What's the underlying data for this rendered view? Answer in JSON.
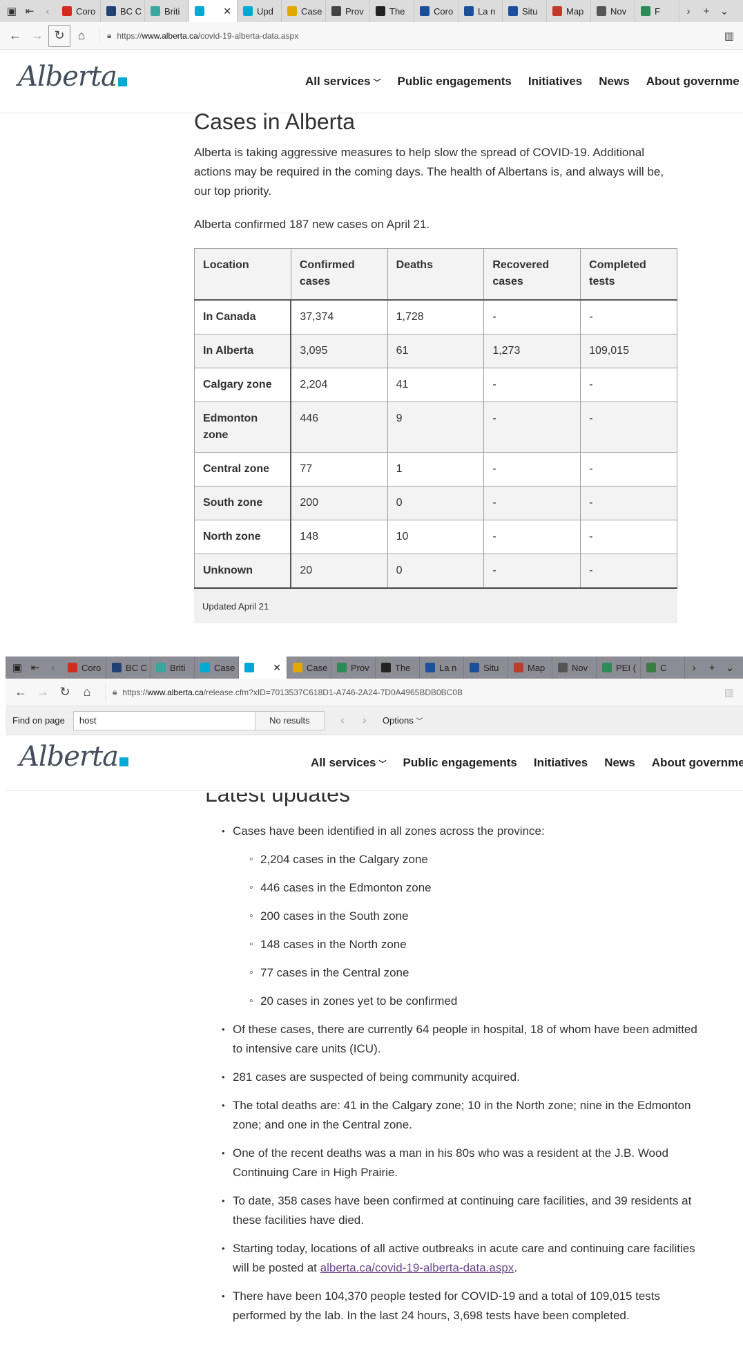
{
  "window1": {
    "tabs": [
      {
        "title": "Coro",
        "color": "#d52b1e",
        "active": false
      },
      {
        "title": "BC C",
        "color": "#234075",
        "active": false
      },
      {
        "title": "Briti",
        "color": "#3aa6a0",
        "active": false
      },
      {
        "title": "",
        "color": "#00aad2",
        "active": true
      },
      {
        "title": "Upd",
        "color": "#00aad2",
        "active": false
      },
      {
        "title": "Case",
        "color": "#e0a800",
        "active": false
      },
      {
        "title": "Prov",
        "color": "#444444",
        "active": false
      },
      {
        "title": "The",
        "color": "#222222",
        "active": false
      },
      {
        "title": "Coro",
        "color": "#1b4f9c",
        "active": false
      },
      {
        "title": "La n",
        "color": "#1b4f9c",
        "active": false
      },
      {
        "title": "Situ",
        "color": "#1b4f9c",
        "active": false
      },
      {
        "title": "Map",
        "color": "#c0392b",
        "active": false
      },
      {
        "title": "Nov",
        "color": "#555555",
        "active": false
      },
      {
        "title": "F",
        "color": "#2e8b57",
        "active": false
      }
    ],
    "url_prefix": "https://",
    "url_host": "www.alberta.ca",
    "url_path": "/covid-19-alberta-data.aspx"
  },
  "header": {
    "logo_text": "Alberta",
    "nav": {
      "all_services": "All services",
      "public_engagements": "Public engagements",
      "initiatives": "Initiatives",
      "news": "News",
      "about": "About governme"
    }
  },
  "page1": {
    "title": "Cases in Alberta",
    "intro": "Alberta is taking aggressive measures to help slow the spread of COVID-19. Additional actions may be required in the coming days. The health of Albertans is, and always will be, our top priority.",
    "new_cases": "Alberta confirmed 187 new cases on April 21.",
    "table": {
      "headers": [
        "Location",
        "Confirmed cases",
        "Deaths",
        "Recovered cases",
        "Completed tests"
      ],
      "rows": [
        [
          "In Canada",
          "37,374",
          "1,728",
          "-",
          "-"
        ],
        [
          "In Alberta",
          "3,095",
          "61",
          "1,273",
          "109,015"
        ],
        [
          "Calgary zone",
          "2,204",
          "41",
          "-",
          "-"
        ],
        [
          "Edmonton zone",
          "446",
          "9",
          "-",
          "-"
        ],
        [
          "Central zone",
          "77",
          "1",
          "-",
          "-"
        ],
        [
          "South zone",
          "200",
          "0",
          "-",
          "-"
        ],
        [
          "North zone",
          "148",
          "10",
          "-",
          "-"
        ],
        [
          "Unknown",
          "20",
          "0",
          "-",
          "-"
        ]
      ],
      "caption": "Updated April 21"
    }
  },
  "window2": {
    "tabs": [
      {
        "title": "Coro",
        "color": "#d52b1e",
        "active": false
      },
      {
        "title": "BC C",
        "color": "#234075",
        "active": false
      },
      {
        "title": "Briti",
        "color": "#3aa6a0",
        "active": false
      },
      {
        "title": "Case",
        "color": "#00aad2",
        "active": false
      },
      {
        "title": "",
        "color": "#00aad2",
        "active": true
      },
      {
        "title": "Case",
        "color": "#e0a800",
        "active": false
      },
      {
        "title": "Prov",
        "color": "#2e8b57",
        "active": false
      },
      {
        "title": "The",
        "color": "#222222",
        "active": false
      },
      {
        "title": "La n",
        "color": "#1b4f9c",
        "active": false
      },
      {
        "title": "Situ",
        "color": "#1b4f9c",
        "active": false
      },
      {
        "title": "Map",
        "color": "#c0392b",
        "active": false
      },
      {
        "title": "Nov",
        "color": "#555555",
        "active": false
      },
      {
        "title": "PEI (",
        "color": "#2e8b57",
        "active": false
      },
      {
        "title": "C",
        "color": "#3a7d44",
        "active": false
      }
    ],
    "url_prefix": "https://",
    "url_host": "www.alberta.ca",
    "url_path": "/release.cfm?xID=7013537C618D1-A746-2A24-7D0A4965BDB0BC0B",
    "find": {
      "label": "Find on page",
      "query": "host",
      "results": "No results",
      "options": "Options"
    }
  },
  "page2": {
    "heading": "Latest updates",
    "bullets": [
      {
        "text": "Cases have been identified in all zones across the province:",
        "sub": [
          "2,204 cases in the Calgary zone",
          "446 cases in the Edmonton zone",
          "200 cases in the South zone",
          "148 cases in the North zone",
          "77 cases in the Central zone",
          "20 cases in zones yet to be confirmed"
        ]
      },
      {
        "text": "Of these cases, there are currently 64 people in hospital, 18 of whom have been admitted to intensive care units (ICU)."
      },
      {
        "text": "281 cases are suspected of being community acquired."
      },
      {
        "text": "The total deaths are: 41 in the Calgary zone; 10 in the North zone; nine in the Edmonton zone; and one in the Central zone."
      },
      {
        "text": "One of the recent deaths was a man in his 80s who was a resident at the J.B. Wood Continuing Care in High Prairie."
      },
      {
        "text": "To date, 358 cases have been confirmed at continuing care facilities, and 39 residents at these facilities have died."
      },
      {
        "text": "Starting today, locations of all active outbreaks in acute care and continuing care facilities will be posted at ",
        "link": "alberta.ca/covid-19-alberta-data.aspx",
        "after": "."
      },
      {
        "text": "There have been 104,370 people tested for COVID-19 and a total of 109,015 tests performed by the lab. In the last 24 hours, 3,698 tests have been completed."
      }
    ]
  }
}
